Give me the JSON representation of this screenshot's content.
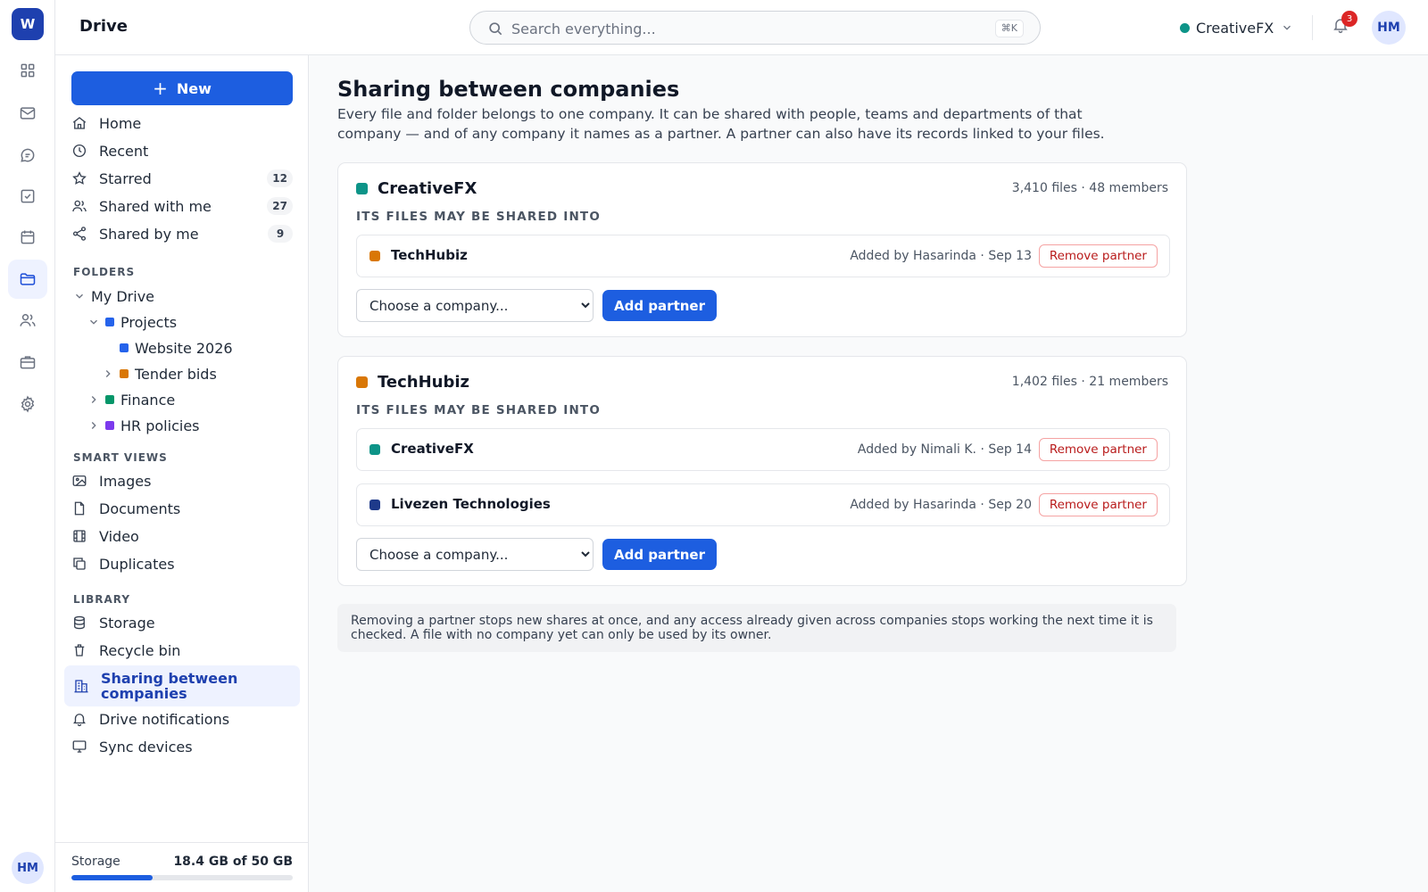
{
  "rail": {
    "logo": "W",
    "items": [
      "grid-icon",
      "mail-icon",
      "chat-icon",
      "tasks-icon",
      "calendar-icon",
      "folder-icon",
      "people-icon",
      "briefcase-icon",
      "settings-icon"
    ],
    "active": "folder-icon",
    "avatar": "HM"
  },
  "topbar": {
    "app_title": "Drive",
    "search_placeholder": "Search everything...",
    "search_shortcut": "⌘K",
    "company": "CreativeFX",
    "company_color": "#0d9488",
    "notifications_count": "3",
    "avatar": "HM"
  },
  "sidebar": {
    "new_label": "New",
    "nav": [
      {
        "label": "Home",
        "icon": "home-icon"
      },
      {
        "label": "Recent",
        "icon": "clock-icon"
      },
      {
        "label": "Starred",
        "icon": "star-icon",
        "count": "12"
      },
      {
        "label": "Shared with me",
        "icon": "users-icon",
        "count": "27"
      },
      {
        "label": "Shared by me",
        "icon": "share-icon",
        "count": "9"
      }
    ],
    "folders_label": "FOLDERS",
    "tree": [
      {
        "label": "My Drive",
        "expanded": true
      },
      {
        "label": "Projects",
        "color": "#2563eb",
        "expanded": true
      },
      {
        "label": "Website 2026",
        "color": "#2563eb"
      },
      {
        "label": "Tender bids",
        "color": "#d97706"
      },
      {
        "label": "Finance",
        "color": "#059669"
      },
      {
        "label": "HR policies",
        "color": "#7c3aed"
      }
    ],
    "smart_views_label": "SMART VIEWS",
    "smart_views": [
      {
        "label": "Images",
        "icon": "image-icon"
      },
      {
        "label": "Documents",
        "icon": "document-icon"
      },
      {
        "label": "Video",
        "icon": "film-icon"
      },
      {
        "label": "Duplicates",
        "icon": "copy-icon"
      }
    ],
    "library_label": "LIBRARY",
    "library": [
      {
        "label": "Storage",
        "icon": "database-icon"
      },
      {
        "label": "Recycle bin",
        "icon": "trash-icon"
      },
      {
        "label": "Sharing between companies",
        "icon": "building-icon",
        "active": true
      },
      {
        "label": "Drive notifications",
        "icon": "bell-icon"
      },
      {
        "label": "Sync devices",
        "icon": "monitor-icon"
      }
    ],
    "storage": {
      "label": "Storage",
      "value": "18.4 GB of 50 GB",
      "used_fraction": 0.368
    }
  },
  "main": {
    "title": "Sharing between companies",
    "description": "Every file and folder belongs to one company. It can be shared with people, teams and departments of that company — and of any company it names as a partner. A partner can also have its records linked to your files.",
    "companies": [
      {
        "name": "CreativeFX",
        "color": "#0d9488",
        "meta": "3,410 files · 48 members",
        "subheading": "ITS FILES MAY BE SHARED INTO",
        "partners": [
          {
            "name": "TechHubiz",
            "color": "#d97706",
            "meta": "Added by Hasarinda · Sep 13",
            "remove_label": "Remove partner"
          }
        ],
        "select_placeholder": "Choose a company...",
        "add_label": "Add partner"
      },
      {
        "name": "TechHubiz",
        "color": "#d97706",
        "meta": "1,402 files · 21 members",
        "subheading": "ITS FILES MAY BE SHARED INTO",
        "partners": [
          {
            "name": "CreativeFX",
            "color": "#0d9488",
            "meta": "Added by Nimali K. · Sep 14",
            "remove_label": "Remove partner"
          },
          {
            "name": "Livezen Technologies",
            "color": "#1e3a8a",
            "meta": "Added by Hasarinda · Sep 20",
            "remove_label": "Remove partner"
          }
        ],
        "select_placeholder": "Choose a company...",
        "add_label": "Add partner"
      }
    ],
    "note": "Removing a partner stops new shares at once, and any access already given across companies stops working the next time it is checked. A file with no company yet can only be used by its owner."
  }
}
